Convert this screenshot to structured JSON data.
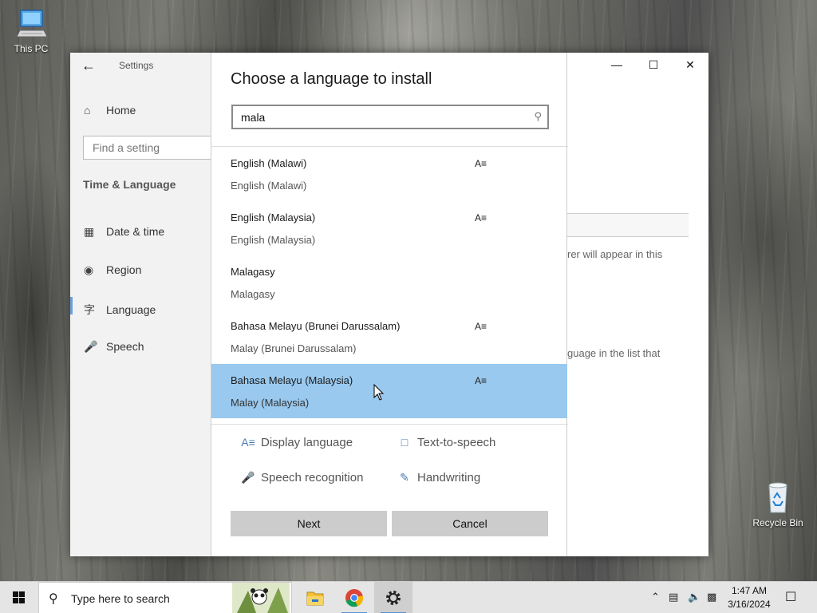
{
  "desktop": {
    "this_pc_label": "This PC",
    "recycle_bin_label": "Recycle Bin"
  },
  "settings": {
    "title": "Settings",
    "home_label": "Home",
    "find_placeholder": "Find a setting",
    "section_heading": "Time & Language",
    "nav": [
      {
        "label": "Date & time",
        "icon": "calendar-clock-icon"
      },
      {
        "label": "Region",
        "icon": "globe-icon"
      },
      {
        "label": "Language",
        "icon": "language-icon"
      },
      {
        "label": "Speech",
        "icon": "microphone-icon"
      }
    ],
    "active_nav": "Language",
    "background_text_1": "rer will appear in this",
    "background_text_2": "guage in the list that"
  },
  "dialog": {
    "title": "Choose a language to install",
    "search_value": "mala",
    "languages": [
      {
        "native": "English (Malawi)",
        "english": "English (Malawi)",
        "display_language_feature": true,
        "selected": false
      },
      {
        "native": "English (Malaysia)",
        "english": "English (Malaysia)",
        "display_language_feature": true,
        "selected": false
      },
      {
        "native": "Malagasy",
        "english": "Malagasy",
        "display_language_feature": false,
        "selected": false
      },
      {
        "native": "Bahasa Melayu (Brunei Darussalam)",
        "english": "Malay (Brunei Darussalam)",
        "display_language_feature": true,
        "selected": false
      },
      {
        "native": "Bahasa Melayu (Malaysia)",
        "english": "Malay (Malaysia)",
        "display_language_feature": true,
        "selected": true
      }
    ],
    "legend": {
      "display_language": "Display language",
      "text_to_speech": "Text-to-speech",
      "speech_recognition": "Speech recognition",
      "handwriting": "Handwriting"
    },
    "next_label": "Next",
    "cancel_label": "Cancel"
  },
  "taskbar": {
    "search_placeholder": "Type here to search",
    "apps": [
      "file-explorer-icon",
      "chrome-icon",
      "settings-gear-icon"
    ],
    "time": "1:47 AM",
    "date": "3/16/2024"
  },
  "colors": {
    "selected_row": "#99c9ef",
    "accent": "#4a7bb5",
    "button_bg": "#cccccc"
  }
}
